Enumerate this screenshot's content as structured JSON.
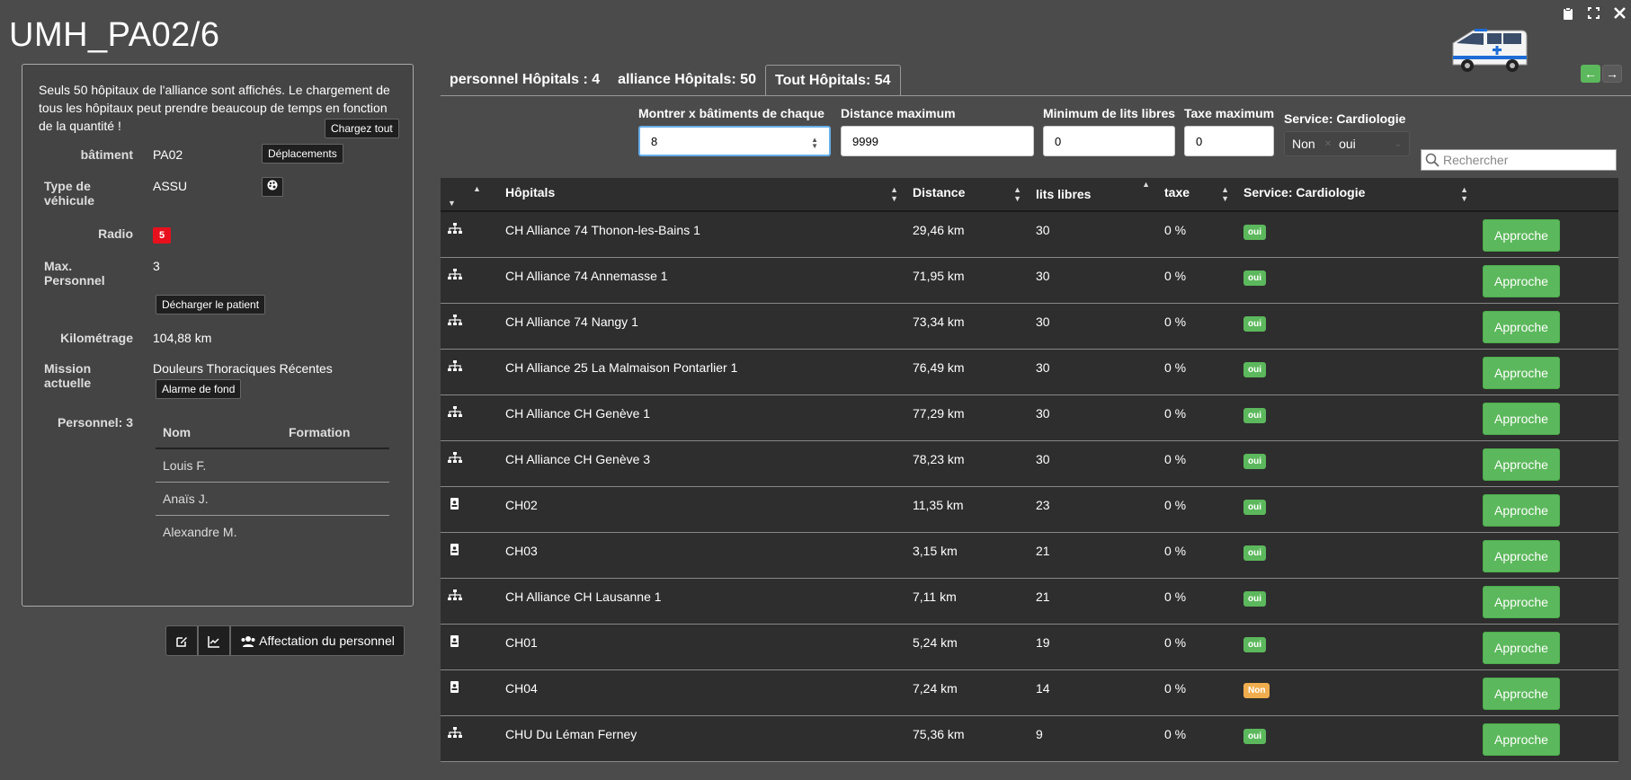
{
  "title": "UMH_PA02/6",
  "window": {
    "icons": [
      "clipboard-icon",
      "fullscreen-icon",
      "close-icon"
    ]
  },
  "panel": {
    "notice": "Seuls 50 hôpitaux de l'alliance sont affichés. Le chargement de tous les hôpitaux peut prendre beaucoup de temps en fonction de la quantité !",
    "load_all": "Chargez tout",
    "batiment_label": "bâtiment",
    "batiment_value": "PA02",
    "deplacements": "Déplacements",
    "type_label": "Type de véhicule",
    "type_value": "ASSU",
    "radio_label": "Radio",
    "radio_value": "5",
    "max_label": "Max. Personnel",
    "max_value": "3",
    "decharger": "Décharger le patient",
    "km_label": "Kilométrage",
    "km_value": "104,88 km",
    "mission_label": "Mission actuelle",
    "mission_value": "Douleurs Thoraciques Récentes",
    "alarme": "Alarme de fond",
    "personnel_label": "Personnel: 3",
    "pers_headers": [
      "Nom",
      "Formation"
    ],
    "personnel": [
      "Louis F.",
      "Anaïs J.",
      "Alexandre M."
    ]
  },
  "bottom": {
    "affectation": "Affectation du personnel"
  },
  "tabs": [
    "personnel Hôpitals : 4",
    "alliance Hôpitals: 50",
    "Tout Hôpitals: 54"
  ],
  "filters": {
    "show_x_label": "Montrer x bâtiments de chaque",
    "show_x_value": "8",
    "distance_label": "Distance maximum",
    "distance_value": "9999",
    "min_beds_label": "Minimum de lits libres",
    "min_beds_value": "0",
    "tax_label": "Taxe maximum",
    "tax_value": "0",
    "service_label": "Service: Cardiologie",
    "service_options": [
      "Non",
      "oui"
    ],
    "search_placeholder": "Rechercher"
  },
  "table": {
    "headers": [
      "Hôpitals",
      "Distance",
      "lits libres",
      "taxe",
      "Service: Cardiologie"
    ],
    "action_label": "Approche",
    "rows": [
      {
        "icon": "sitemap-icon",
        "name": "CH Alliance 74 Thonon-les-Bains 1",
        "distance": "29,46 km",
        "beds": "30",
        "tax": "0 %",
        "service": "oui"
      },
      {
        "icon": "sitemap-icon",
        "name": "CH Alliance 74 Annemasse 1",
        "distance": "71,95 km",
        "beds": "30",
        "tax": "0 %",
        "service": "oui"
      },
      {
        "icon": "sitemap-icon",
        "name": "CH Alliance 74 Nangy 1",
        "distance": "73,34 km",
        "beds": "30",
        "tax": "0 %",
        "service": "oui"
      },
      {
        "icon": "sitemap-icon",
        "name": "CH Alliance 25 La Malmaison Pontarlier 1",
        "distance": "76,49 km",
        "beds": "30",
        "tax": "0 %",
        "service": "oui"
      },
      {
        "icon": "sitemap-icon",
        "name": "CH Alliance CH Genève 1",
        "distance": "77,29 km",
        "beds": "30",
        "tax": "0 %",
        "service": "oui"
      },
      {
        "icon": "sitemap-icon",
        "name": "CH Alliance CH Genève 3",
        "distance": "78,23 km",
        "beds": "30",
        "tax": "0 %",
        "service": "oui"
      },
      {
        "icon": "portrait-icon",
        "name": "CH02",
        "distance": "11,35 km",
        "beds": "23",
        "tax": "0 %",
        "service": "oui"
      },
      {
        "icon": "portrait-icon",
        "name": "CH03",
        "distance": "3,15 km",
        "beds": "21",
        "tax": "0 %",
        "service": "oui"
      },
      {
        "icon": "sitemap-icon",
        "name": "CH Alliance CH Lausanne 1",
        "distance": "7,11 km",
        "beds": "21",
        "tax": "0 %",
        "service": "oui"
      },
      {
        "icon": "portrait-icon",
        "name": "CH01",
        "distance": "5,24 km",
        "beds": "19",
        "tax": "0 %",
        "service": "oui"
      },
      {
        "icon": "portrait-icon",
        "name": "CH04",
        "distance": "7,24 km",
        "beds": "14",
        "tax": "0 %",
        "service": "Non"
      },
      {
        "icon": "sitemap-icon",
        "name": "CHU Du Léman Ferney",
        "distance": "75,36 km",
        "beds": "9",
        "tax": "0 %",
        "service": "oui"
      }
    ]
  }
}
